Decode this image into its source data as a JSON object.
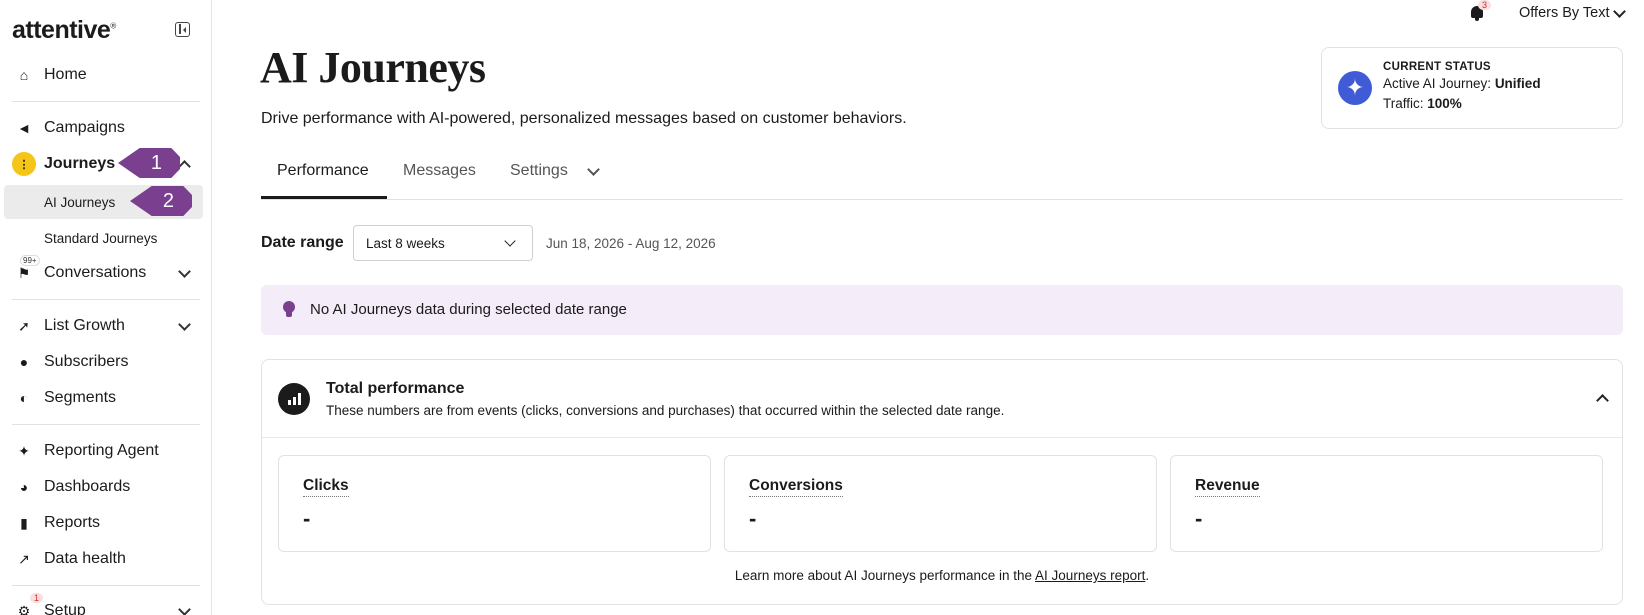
{
  "sidebar": {
    "logo": "attentive",
    "logo_mark": "®",
    "items": [
      {
        "label": "Home",
        "icon": "home-icon"
      },
      {
        "label": "Campaigns",
        "icon": "megaphone-icon"
      },
      {
        "label": "Journeys",
        "icon": "journeys-icon"
      },
      {
        "label": "AI Journeys"
      },
      {
        "label": "Standard Journeys"
      },
      {
        "label": "Conversations",
        "icon": "conversations-icon",
        "badge": "99+"
      },
      {
        "label": "List Growth",
        "icon": "rocket-icon"
      },
      {
        "label": "Subscribers",
        "icon": "people-icon"
      },
      {
        "label": "Segments",
        "icon": "segments-icon"
      },
      {
        "label": "Reporting Agent",
        "icon": "sparkle-icon"
      },
      {
        "label": "Dashboards",
        "icon": "pie-icon"
      },
      {
        "label": "Reports",
        "icon": "bar-chart-icon"
      },
      {
        "label": "Data health",
        "icon": "line-chart-icon"
      },
      {
        "label": "Setup",
        "icon": "gear-icon",
        "badge": "1"
      }
    ],
    "markers": [
      "1",
      "2"
    ]
  },
  "topbar": {
    "notification_count": "3",
    "account_name": "Offers By Text"
  },
  "header": {
    "title": "AI Journeys",
    "subtitle": "Drive performance with AI-powered, personalized messages based on customer behaviors."
  },
  "status": {
    "heading": "CURRENT STATUS",
    "journey_label": "Active AI Journey: ",
    "journey_value": "Unified",
    "traffic_label": "Traffic: ",
    "traffic_value": "100%"
  },
  "tabs": [
    {
      "label": "Performance"
    },
    {
      "label": "Messages"
    },
    {
      "label": "Settings"
    }
  ],
  "date_range": {
    "label": "Date range",
    "selected": "Last 8 weeks",
    "range_text": "Jun 18, 2026 - Aug 12, 2026"
  },
  "alert": {
    "text": "No AI Journeys data during selected date range"
  },
  "performance": {
    "title": "Total performance",
    "description": "These numbers are from events (clicks, conversions and purchases) that occurred within the selected date range.",
    "metrics": [
      {
        "label": "Clicks",
        "value": "-"
      },
      {
        "label": "Conversions",
        "value": "-"
      },
      {
        "label": "Revenue",
        "value": "-"
      }
    ],
    "footer_text": "Learn more about AI Journeys performance in the ",
    "footer_link": "AI Journeys report",
    "footer_end": "."
  },
  "colors": {
    "accent_purple": "#7b3f8f",
    "status_blue": "#3f5bd6",
    "journeys_yellow": "#f5c518",
    "alert_bg": "#f4ecf8"
  }
}
